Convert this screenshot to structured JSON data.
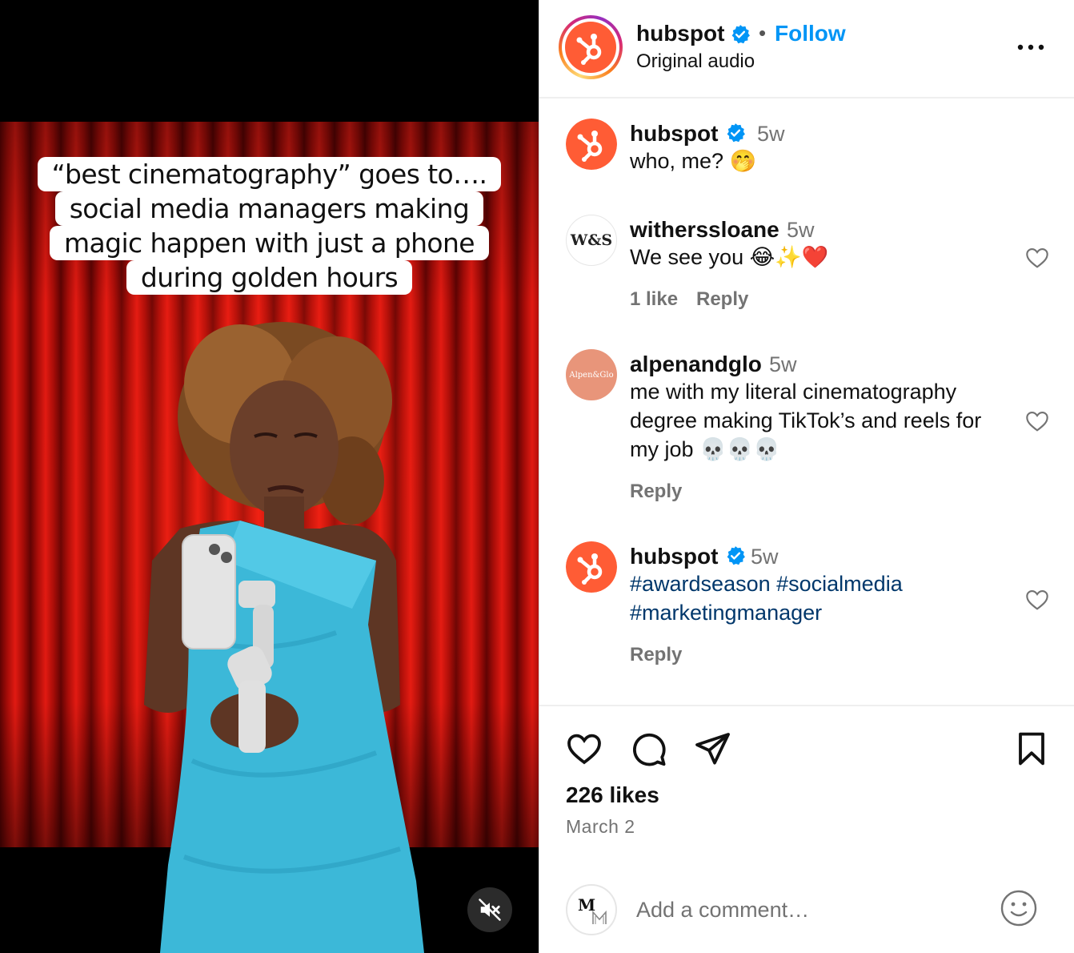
{
  "video": {
    "caption_lines": [
      "“best cinematography” goes to….",
      "social media managers making",
      "magic happen with just a phone",
      "during golden hours"
    ],
    "muted_icon": "speaker-muted-icon"
  },
  "post_header": {
    "username": "hubspot",
    "verified": true,
    "separator": "•",
    "follow_label": "Follow",
    "audio_label": "Original audio",
    "more_icon": "ellipsis-icon"
  },
  "comments": [
    {
      "username": "hubspot",
      "verified": true,
      "time": "5w",
      "text": "who, me? 🤭",
      "avatar": "hubspot-logo"
    },
    {
      "username": "witherssloane",
      "verified": false,
      "time": "5w",
      "text": "We see you 😂✨❤️",
      "likes_label": "1 like",
      "reply_label": "Reply",
      "avatar_text": "W&S"
    },
    {
      "username": "alpenandglo",
      "verified": false,
      "time": "5w",
      "text_lines": [
        "me with my literal cinematography",
        "degree making TikTok’s and reels for",
        "my job 💀💀💀"
      ],
      "reply_label": "Reply",
      "avatar_text": "Alpen&Glo"
    },
    {
      "username": "hubspot",
      "verified": true,
      "time": "5w",
      "text_lines": [
        "#awardseason #socialmedia",
        "#marketingmanager"
      ],
      "reply_label": "Reply",
      "avatar": "hubspot-logo"
    }
  ],
  "actions": {
    "like_icon": "heart-icon",
    "comment_icon": "comment-bubble-icon",
    "share_icon": "paper-plane-icon",
    "save_icon": "bookmark-icon",
    "likes_label": "226 likes",
    "date_label": "March 2"
  },
  "add_comment": {
    "placeholder": "Add a comment…",
    "avatar_text": "M",
    "emoji_icon": "smiley-icon"
  },
  "colors": {
    "brand_orange": "#ff5c35",
    "follow_blue": "#0095f6",
    "hashtag_blue": "#00376b",
    "secondary_text": "#737373",
    "verified_blue": "#0095f6"
  }
}
